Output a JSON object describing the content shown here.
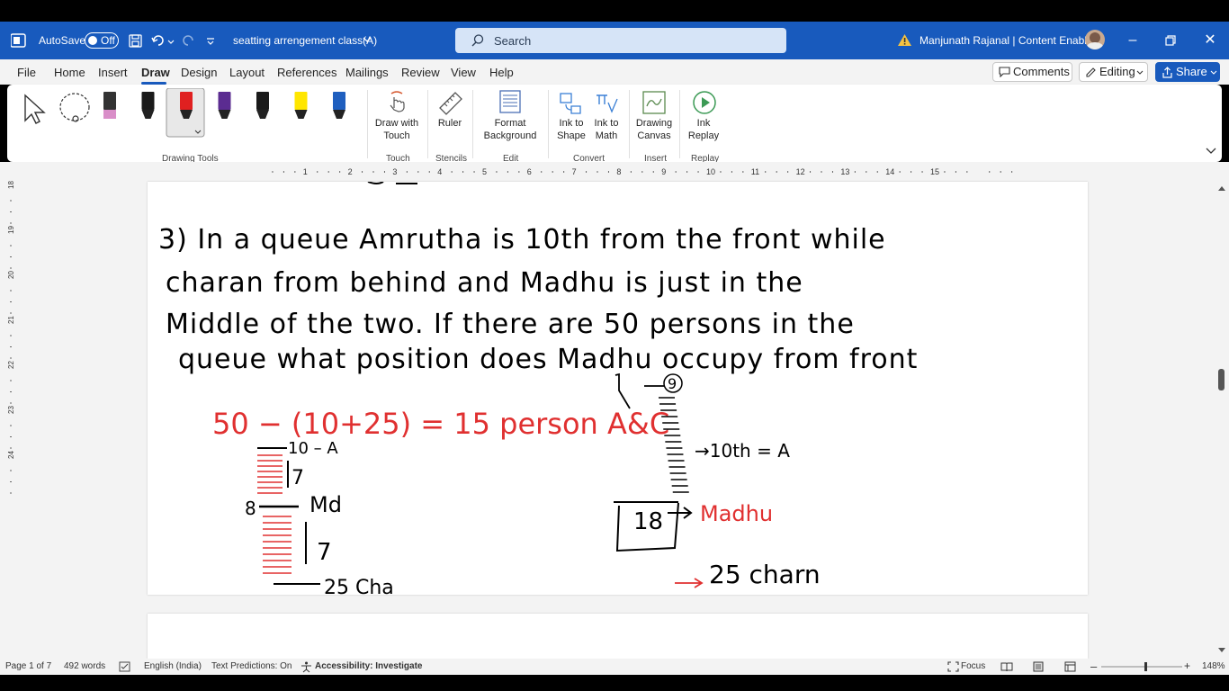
{
  "title_bar": {
    "autosave_label": "AutoSave",
    "autosave_state": "Off",
    "document_name": "seatting arrengement class(A)",
    "search_placeholder": "Search",
    "user_name": "Manjunath Rajanal | Content Enablers"
  },
  "menu": {
    "tabs": [
      "File",
      "Home",
      "Insert",
      "Draw",
      "Design",
      "Layout",
      "References",
      "Mailings",
      "Review",
      "View",
      "Help"
    ],
    "active_tab": "Draw",
    "comments_label": "Comments",
    "editing_label": "Editing",
    "share_label": "Share"
  },
  "ribbon": {
    "groups": {
      "drawing_tools": "Drawing Tools",
      "touch": "Touch",
      "stencils": "Stencils",
      "edit": "Edit",
      "convert": "Convert",
      "insert": "Insert",
      "replay": "Replay"
    },
    "buttons": {
      "draw_with_touch_1": "Draw with",
      "draw_with_touch_2": "Touch",
      "ruler": "Ruler",
      "format_bg_1": "Format",
      "format_bg_2": "Background",
      "ink_to_shape_1": "Ink to",
      "ink_to_shape_2": "Shape",
      "ink_to_math_1": "Ink to",
      "ink_to_math_2": "Math",
      "drawing_canvas_1": "Drawing",
      "drawing_canvas_2": "Canvas",
      "ink_replay_1": "Ink",
      "ink_replay_2": "Replay"
    },
    "pen_colors": [
      "#ffe14d",
      "#1a1a1a",
      "#e02020",
      "#5b2c91",
      "#1a1a1a",
      "#ffe600",
      "#1f5fbf"
    ]
  },
  "ruler": {
    "h_ticks": [
      "1",
      "2",
      "3",
      "4",
      "5",
      "6",
      "7",
      "8",
      "9",
      "10",
      "11",
      "12",
      "13",
      "14",
      "15"
    ],
    "v_ticks": [
      "18",
      "19",
      "20",
      "21",
      "22",
      "23",
      "24"
    ]
  },
  "document": {
    "question_lines": [
      "3) In a queue Amrutha is 10th from the front while",
      "charan from behind and Madhu is just in the",
      "Middle of the two. If there are 50 persons in the",
      "queue  what position does Madhu occupy from front"
    ],
    "calc": "50 − (10+25) = 15 person A&C",
    "left_diagram": [
      "10 – A",
      "7",
      "8",
      "Md",
      "7",
      "25 Cha"
    ],
    "right_diagram": [
      "9",
      "→10th = A",
      "18",
      "Madhu",
      "25 charn"
    ]
  },
  "status_bar": {
    "page": "Page 1 of 7",
    "words": "492 words",
    "language": "English (India)",
    "text_predictions": "Text Predictions: On",
    "accessibility": "Accessibility: Investigate",
    "focus": "Focus",
    "zoom": "148%"
  }
}
